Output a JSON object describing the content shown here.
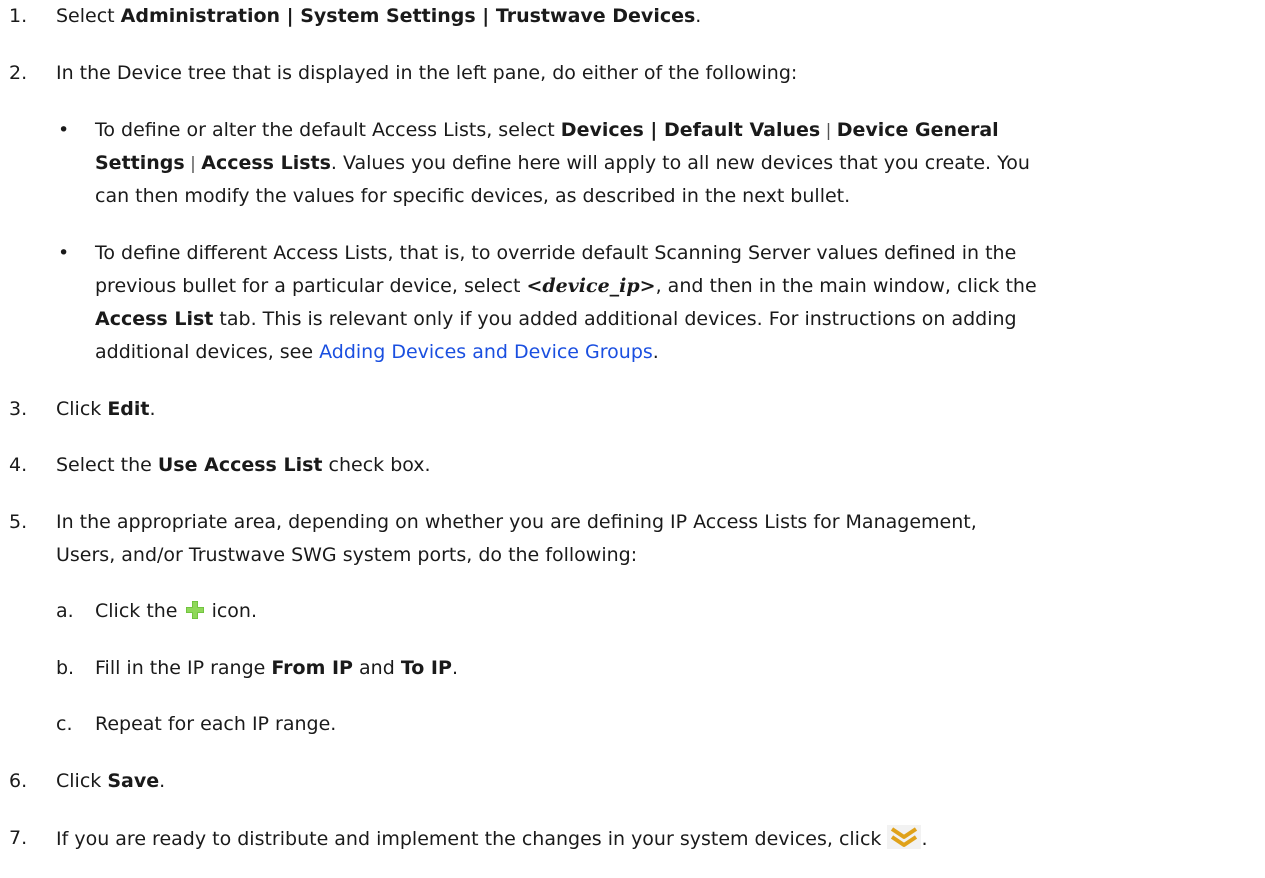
{
  "steps": {
    "s1": {
      "num": "1.",
      "pre": "Select ",
      "bold": "Administration | System Settings | Trustwave Devices",
      "post": "."
    },
    "s2": {
      "num": "2.",
      "text": "In the Device tree that is displayed in the left pane, do either of the following:"
    },
    "b1": {
      "bullet": "•",
      "l1_pre": "To define or alter the default Access Lists, select ",
      "l1_b1": "Devices | Default Values",
      "sep1": " | ",
      "l1_b2": "Device General",
      "l2_b2": "Settings",
      "sep2": " | ",
      "l2_b3": "Access Lists",
      "l2_post": ". Values you define here will apply to all new devices that you create. You",
      "l3": "can then modify the values for specific devices, as described in the next bullet."
    },
    "b2": {
      "bullet": "•",
      "l1": "To define different Access Lists, that is, to override default Scanning Server values defined in the",
      "l2_pre": "previous bullet for a particular device, select ",
      "l2_ital": "<device_ip>",
      "l2_post": ", and then in the main window, click the",
      "l3_b": "Access List",
      "l3_post": " tab. This is relevant only if you added additional devices. For instructions on adding",
      "l4_pre": "additional devices, see ",
      "l4_link": "Adding Devices and Device Groups",
      "l4_post": "."
    },
    "s3": {
      "num": "3.",
      "pre": "Click ",
      "bold": "Edit",
      "post": "."
    },
    "s4": {
      "num": "4.",
      "pre": "Select the ",
      "bold": "Use Access List",
      "post": " check box."
    },
    "s5": {
      "num": "5.",
      "l1": "In the appropriate area, depending on whether you are defining IP Access Lists for Management,",
      "l2": "Users, and/or Trustwave SWG system ports, do the following:"
    },
    "sa": {
      "letter": "a.",
      "pre": "Click the ",
      "post": " icon."
    },
    "sb": {
      "letter": "b.",
      "pre": "Fill in the IP range ",
      "b1": "From IP",
      "mid": " and ",
      "b2": "To IP",
      "post": "."
    },
    "sc": {
      "letter": "c.",
      "text": "Repeat for each IP range."
    },
    "s6": {
      "num": "6.",
      "pre": "Click ",
      "bold": "Save",
      "post": "."
    },
    "s7": {
      "num": "7.",
      "text": "If you are ready to distribute and implement the changes in your system devices, click ",
      "post": "."
    }
  },
  "icons": {
    "add": "plus-icon",
    "distribute": "double-chevron-down-icon",
    "add_color": "#6cbf3a",
    "distribute_color": "#e0a21a"
  },
  "colors": {
    "link": "#1a4fe0",
    "text": "#1a1a1a"
  }
}
